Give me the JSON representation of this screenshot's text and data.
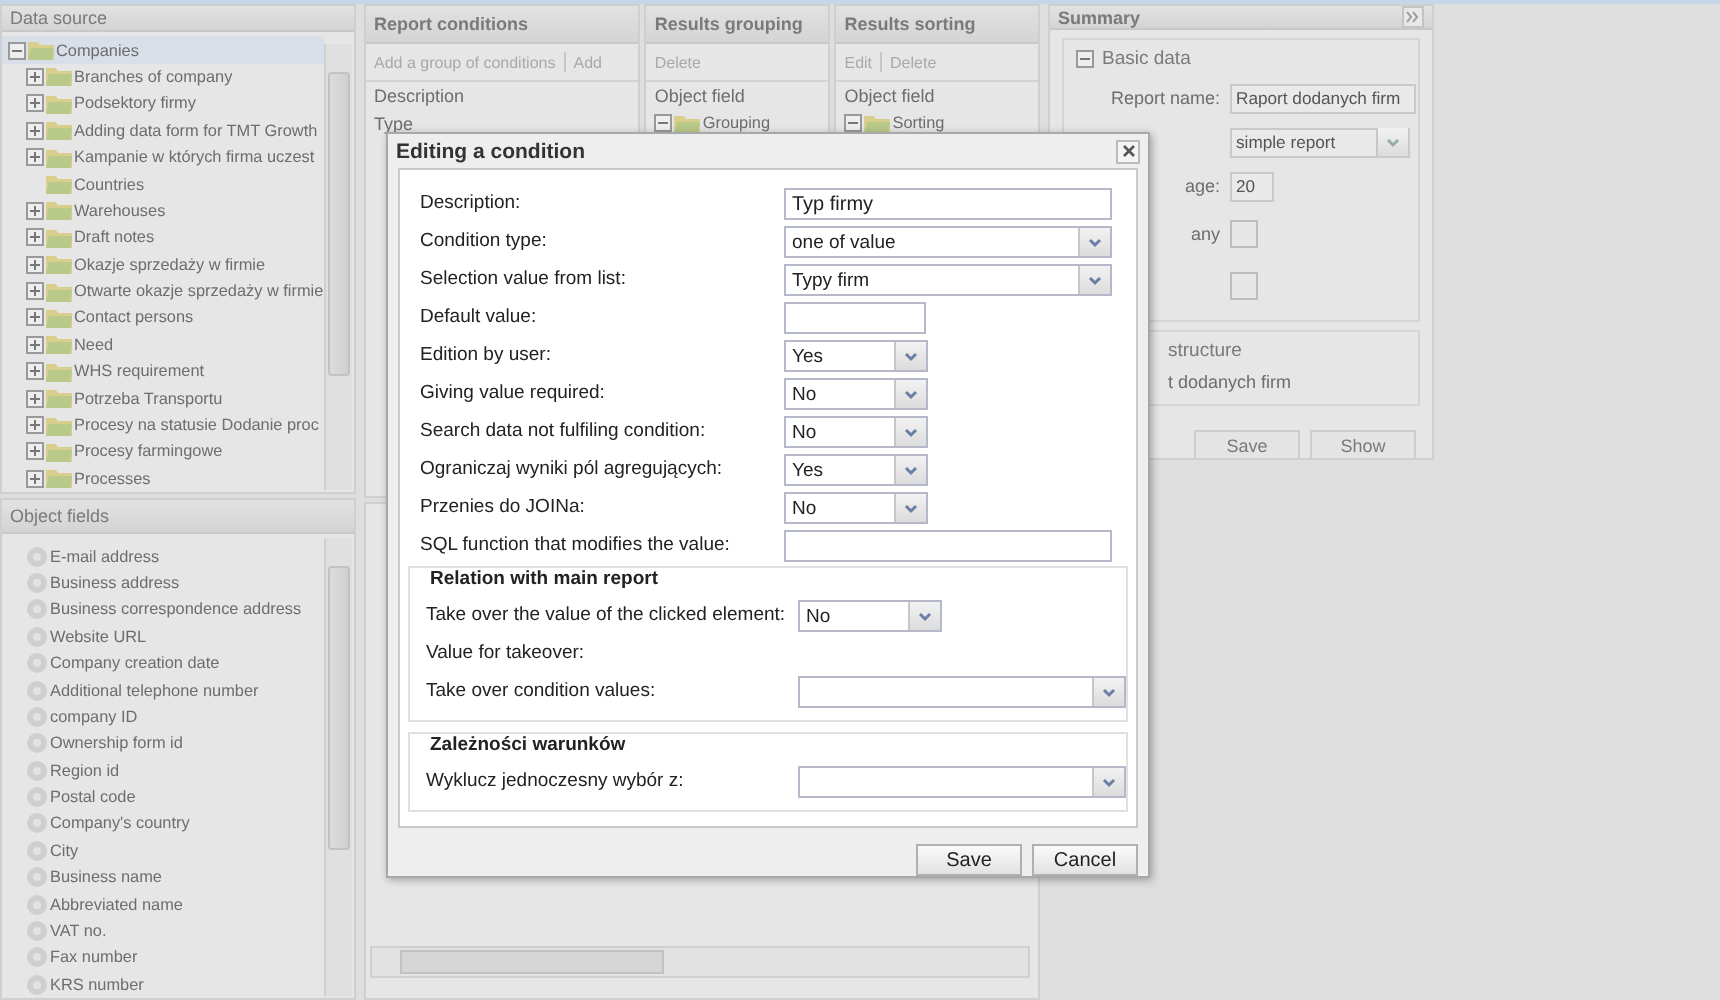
{
  "data_source": {
    "title": "Data source",
    "tree": [
      {
        "label": "Companies",
        "kind": "branch",
        "expanded": true,
        "selected": true,
        "children": [
          {
            "label": "Branches of company",
            "kind": "branch",
            "expanded": false,
            "selected": false
          },
          {
            "label": "Podsektory firmy",
            "kind": "branch",
            "expanded": false,
            "selected": false
          },
          {
            "label": "Adding data form for TMT Growth",
            "kind": "branch",
            "expanded": false,
            "selected": false
          },
          {
            "label": "Kampanie w których firma uczest",
            "kind": "branch",
            "expanded": false,
            "selected": false
          },
          {
            "label": "Countries",
            "kind": "leaf",
            "selected": false
          },
          {
            "label": "Warehouses",
            "kind": "branch",
            "expanded": false,
            "selected": false
          },
          {
            "label": "Draft notes",
            "kind": "branch",
            "expanded": false,
            "selected": false
          },
          {
            "label": "Okazje sprzedaży w firmie",
            "kind": "branch",
            "expanded": false,
            "selected": false
          },
          {
            "label": "Otwarte okazje sprzedaży w firmie",
            "kind": "branch",
            "expanded": false,
            "selected": false
          },
          {
            "label": "Contact persons",
            "kind": "branch",
            "expanded": false,
            "selected": false
          },
          {
            "label": "Need",
            "kind": "branch",
            "expanded": false,
            "selected": false
          },
          {
            "label": "WHS requirement",
            "kind": "branch",
            "expanded": false,
            "selected": false
          },
          {
            "label": "Potrzeba Transportu",
            "kind": "branch",
            "expanded": false,
            "selected": false
          },
          {
            "label": "Procesy na statusie Dodanie proc",
            "kind": "branch",
            "expanded": false,
            "selected": false
          },
          {
            "label": "Procesy farmingowe",
            "kind": "branch",
            "expanded": false,
            "selected": false
          },
          {
            "label": "Processes",
            "kind": "branch",
            "expanded": false,
            "selected": false
          }
        ]
      }
    ]
  },
  "object_fields": {
    "title": "Object fields",
    "items": [
      "E-mail address",
      "Business address",
      "Business correspondence address",
      "Website URL",
      "Company creation date",
      "Additional telephone number",
      "company ID",
      "Ownership form id",
      "Region id",
      "Postal code",
      "Company's country",
      "City",
      "Business name",
      "Abbreviated name",
      "VAT no.",
      "Fax number",
      "KRS number"
    ]
  },
  "report_conditions": {
    "title": "Report conditions",
    "toolbar": [
      "Add a group of conditions",
      "Add"
    ],
    "columns": [
      "Description",
      "Type"
    ]
  },
  "results_grouping": {
    "title": "Results grouping",
    "toolbar": [
      "Delete"
    ],
    "column": "Object field",
    "root": "Grouping"
  },
  "results_sorting": {
    "title": "Results sorting",
    "toolbar": [
      "Edit",
      "Delete"
    ],
    "column": "Object field",
    "root": "Sorting"
  },
  "summary": {
    "title": "Summary",
    "basic_data": {
      "title": "Basic data",
      "expanded": true,
      "fields": [
        {
          "label": "Report name:",
          "kind": "text",
          "value": "Raport dodanych firm"
        },
        {
          "kind": "select",
          "value": "simple report"
        },
        {
          "label": "age:",
          "kind": "short_text",
          "value": "20"
        },
        {
          "label": "any",
          "kind": "checkbox",
          "checked": false
        },
        {
          "kind": "checkbox",
          "checked": false
        }
      ]
    },
    "structure": {
      "title": "structure",
      "text": "t dodanych firm"
    },
    "buttons": [
      "Save",
      "Show"
    ]
  },
  "dialog": {
    "title": "Editing a condition",
    "fields": [
      {
        "label": "Description:",
        "kind": "text",
        "value": "Typ firmy"
      },
      {
        "label": "Condition type:",
        "kind": "combo",
        "value": "one of value"
      },
      {
        "label": "Selection value from list:",
        "kind": "combo",
        "value": "Typy firm"
      },
      {
        "label": "Default value:",
        "kind": "short_text"
      },
      {
        "label": "Edition by user:",
        "kind": "short_combo",
        "value": "Yes"
      },
      {
        "label": "Giving value required:",
        "kind": "short_combo",
        "value": "No"
      },
      {
        "label": "Search data not fulfiling condition:",
        "kind": "short_combo",
        "value": "No"
      },
      {
        "label": "Ograniczaj wyniki pól agregujących:",
        "kind": "short_combo",
        "value": "Yes"
      },
      {
        "label": "Przenies do JOINa:",
        "kind": "short_combo",
        "value": "No"
      },
      {
        "label": "SQL function that modifies the value:",
        "kind": "text"
      }
    ],
    "sections": [
      {
        "title": "Relation with main report",
        "fields": [
          {
            "label": "Take over the value of the clicked element:",
            "kind": "short_combo",
            "value": "No"
          },
          {
            "label": "Value for takeover:",
            "kind": "label"
          },
          {
            "label": "Take over condition values:",
            "kind": "combo"
          }
        ]
      },
      {
        "title": "Zależności warunków",
        "fields": [
          {
            "label": "Wyklucz jednoczesny wybór z:",
            "kind": "combo"
          }
        ]
      }
    ],
    "buttons": [
      "Save",
      "Cancel"
    ]
  }
}
